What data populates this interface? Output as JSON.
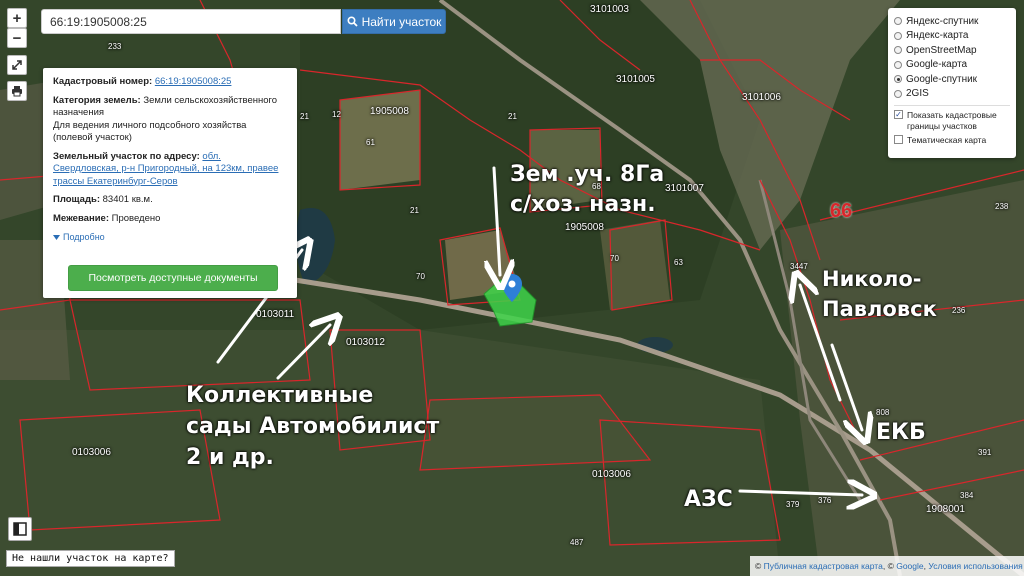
{
  "search": {
    "value": "66:19:1905008:25",
    "button_label": "Найти участок"
  },
  "zoom": {
    "in": "+",
    "out": "−"
  },
  "info": {
    "cadastral_label": "Кадастровый номер:",
    "cadastral_value": "66:19:1905008:25",
    "category_label": "Категория земель:",
    "category_value": "Земли сельскохозяйственного назначения",
    "usage_value": "Для ведения личного подсобного хозяйства (полевой участок)",
    "address_label": "Земельный участок по адресу:",
    "address_value": "обл. Свердловская, р-н Пригородный, на 123км, правее трассы Екатеринбург-Серов",
    "area_label": "Площадь:",
    "area_value": "83401 кв.м.",
    "survey_label": "Межевание:",
    "survey_value": "Проведено",
    "more_label": "Подробно",
    "docs_button": "Посмотреть доступные документы"
  },
  "layers": {
    "options": [
      {
        "label": "Яндекс-спутник",
        "selected": false
      },
      {
        "label": "Яндекс-карта",
        "selected": false
      },
      {
        "label": "OpenStreetMap",
        "selected": false
      },
      {
        "label": "Google-карта",
        "selected": false
      },
      {
        "label": "Google-спутник",
        "selected": true
      },
      {
        "label": "2GIS",
        "selected": false
      }
    ],
    "show_boundaries": "Показать кадастровые границы участков",
    "thematic": "Тематическая карта"
  },
  "not_found": "Не нашли участок на карте?",
  "attribution": {
    "prefix": "©",
    "pkk": "Публичная кадастровая карта",
    "sep": ", ©",
    "google": "Google",
    "terms": "Условия использования"
  },
  "annotations": {
    "plot_line1": "Зем .уч. 8Га",
    "plot_line2": "с/хоз. назн.",
    "gardens_line1": "Коллективные",
    "gardens_line2": "сады Автомобилист",
    "gardens_line3": "2 и др.",
    "town_line1": "Николо-",
    "town_line2": "Павловск",
    "ekb": "ЕКБ",
    "azs": "АЗС"
  },
  "map_labels": {
    "quarters": [
      "3101003",
      "3101005",
      "3101006",
      "1905008",
      "1905008",
      "3101007",
      "0103011",
      "0103012",
      "0103006",
      "0103006",
      "1908001"
    ],
    "parcels": [
      "233",
      "21",
      "12",
      "61",
      "21",
      "68",
      "70",
      "70",
      "63",
      "3447",
      "238",
      "236",
      "808",
      "391",
      "384",
      "376",
      "379",
      "487",
      "21"
    ],
    "region": "66"
  },
  "colors": {
    "boundary": "#d9262b",
    "plot": "#3fd44a",
    "marker": "#2e7fd6",
    "button_blue": "#3d7ec1",
    "button_green": "#4cae4c"
  }
}
